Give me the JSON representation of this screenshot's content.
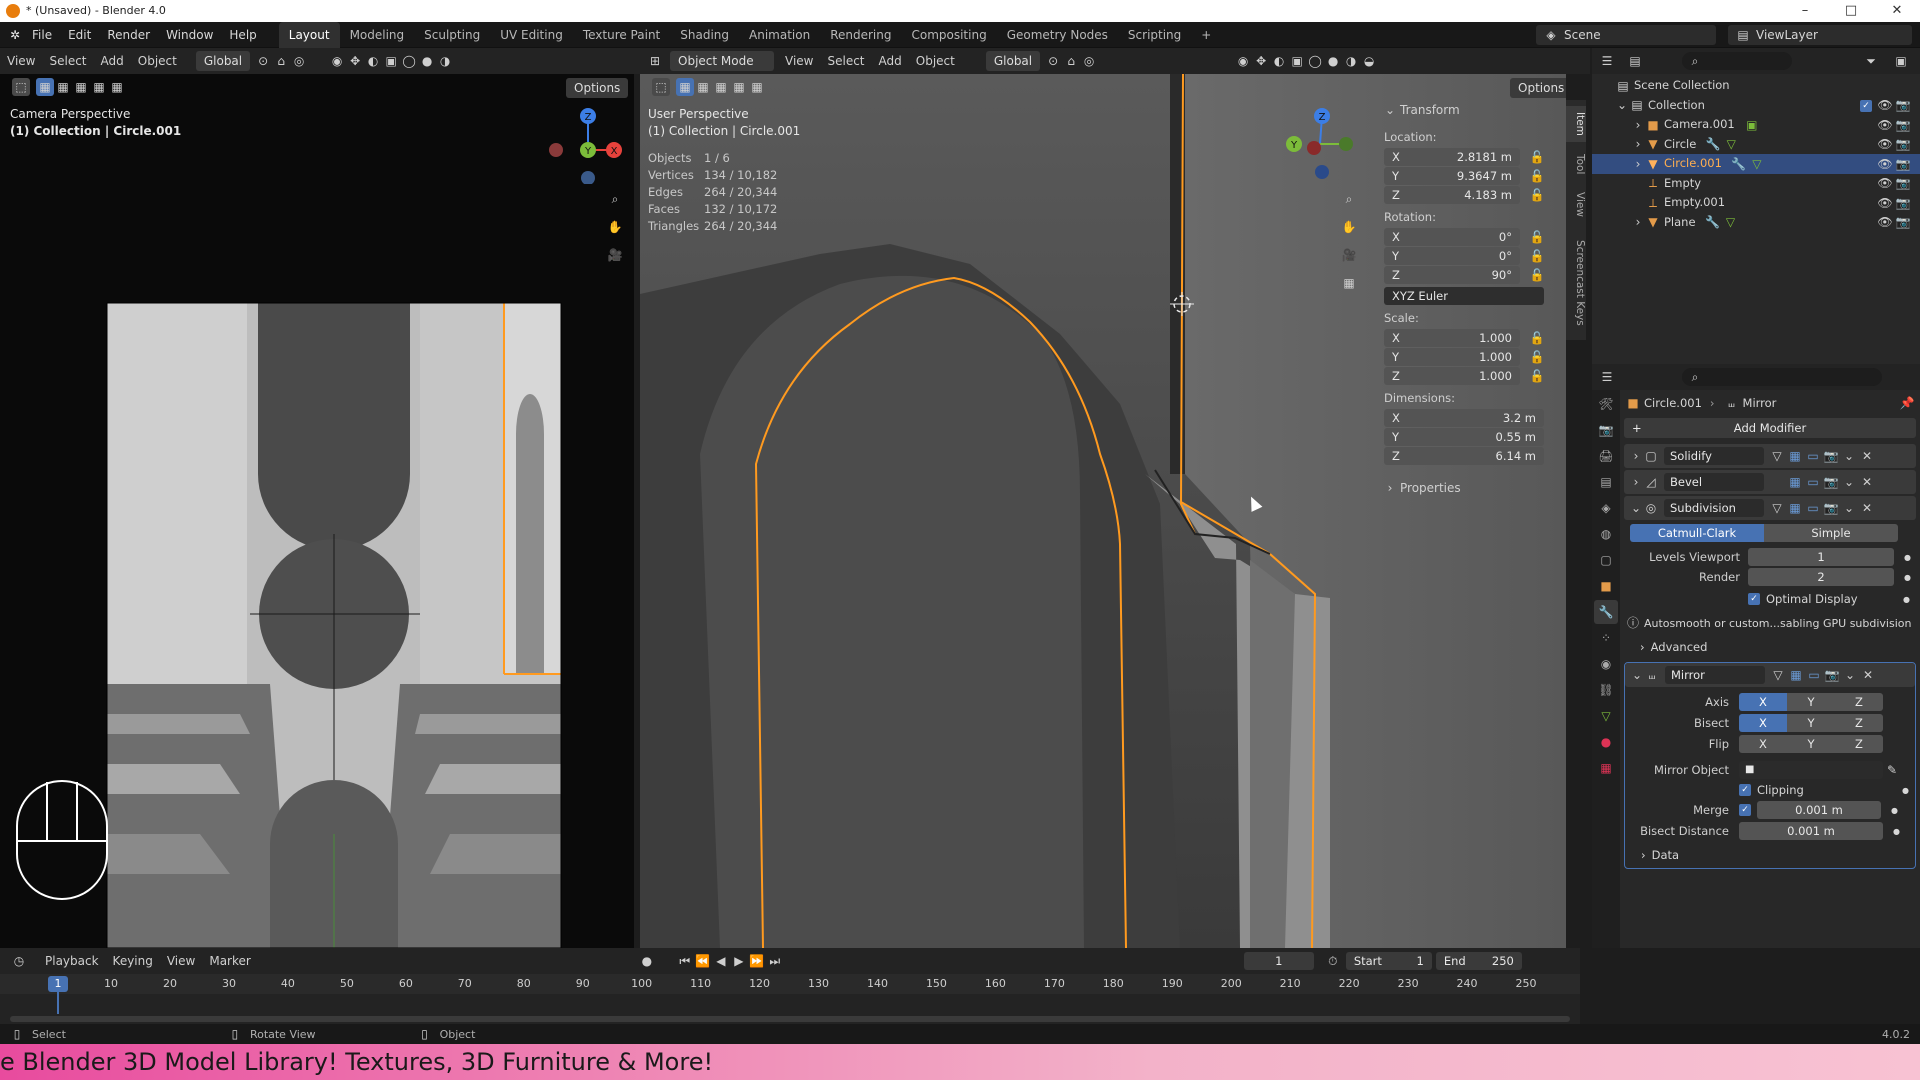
{
  "window": {
    "title": "* (Unsaved) - Blender 4.0",
    "minimize": "–",
    "maximize": "□",
    "close": "✕"
  },
  "menubar": [
    "File",
    "Edit",
    "Render",
    "Window",
    "Help"
  ],
  "workspaces": [
    "Layout",
    "Modeling",
    "Sculpting",
    "UV Editing",
    "Texture Paint",
    "Shading",
    "Animation",
    "Rendering",
    "Compositing",
    "Geometry Nodes",
    "Scripting"
  ],
  "workspace_add": "+",
  "scene": {
    "label": "Scene",
    "view_layer": "ViewLayer"
  },
  "left_view": {
    "header": [
      "View",
      "Select",
      "Add",
      "Object"
    ],
    "orientation": "Global",
    "options": "Options",
    "overlay_title": "Camera Perspective",
    "overlay_sub": "(1) Collection | Circle.001"
  },
  "mid_view": {
    "mode": "Object Mode",
    "header": [
      "View",
      "Select",
      "Add",
      "Object"
    ],
    "orientation": "Global",
    "options": "Options",
    "overlay_title": "User Perspective",
    "overlay_sub": "(1) Collection | Circle.001",
    "stats": [
      {
        "k": "Objects",
        "v": "1 / 6"
      },
      {
        "k": "Vertices",
        "v": "134 / 10,182"
      },
      {
        "k": "Edges",
        "v": "264 / 20,344"
      },
      {
        "k": "Faces",
        "v": "132 / 10,172"
      },
      {
        "k": "Triangles",
        "v": "264 / 20,344"
      }
    ]
  },
  "sidebar_tabs": [
    "Item",
    "Tool",
    "View",
    "Screencast Keys"
  ],
  "transform": {
    "title": "Transform",
    "location_label": "Location:",
    "location": [
      {
        "a": "X",
        "v": "2.8181 m"
      },
      {
        "a": "Y",
        "v": "9.3647 m"
      },
      {
        "a": "Z",
        "v": "4.183 m"
      }
    ],
    "rotation_label": "Rotation:",
    "rotation": [
      {
        "a": "X",
        "v": "0°"
      },
      {
        "a": "Y",
        "v": "0°"
      },
      {
        "a": "Z",
        "v": "90°"
      }
    ],
    "rotation_mode": "XYZ Euler",
    "scale_label": "Scale:",
    "scale": [
      {
        "a": "X",
        "v": "1.000"
      },
      {
        "a": "Y",
        "v": "1.000"
      },
      {
        "a": "Z",
        "v": "1.000"
      }
    ],
    "dimensions_label": "Dimensions:",
    "dimensions": [
      {
        "a": "X",
        "v": "3.2 m"
      },
      {
        "a": "Y",
        "v": "0.55 m"
      },
      {
        "a": "Z",
        "v": "6.14 m"
      }
    ],
    "properties": "Properties"
  },
  "outliner": {
    "root": "Scene Collection",
    "collection": "Collection",
    "items": [
      {
        "name": "Camera.001",
        "selected": false
      },
      {
        "name": "Circle",
        "selected": false
      },
      {
        "name": "Circle.001",
        "selected": true
      },
      {
        "name": "Empty",
        "selected": false
      },
      {
        "name": "Empty.001",
        "selected": false
      },
      {
        "name": "Plane",
        "selected": false
      }
    ]
  },
  "properties": {
    "breadcrumb_object": "Circle.001",
    "breadcrumb_modifier": "Mirror",
    "add_modifier": "Add Modifier",
    "modifiers": [
      "Solidify",
      "Bevel",
      "Subdivision"
    ],
    "subdivision": {
      "catmull": "Catmull-Clark",
      "simple": "Simple",
      "levels_label": "Levels Viewport",
      "levels_value": "1",
      "render_label": "Render",
      "render_value": "2",
      "optimal": "Optimal Display",
      "warning": "Autosmooth or custom...sabling GPU subdivision",
      "advanced": "Advanced"
    },
    "mirror": {
      "name": "Mirror",
      "axis_label": "Axis",
      "bisect_label": "Bisect",
      "flip_label": "Flip",
      "xyz": [
        "X",
        "Y",
        "Z"
      ],
      "mirror_object_label": "Mirror Object",
      "clipping": "Clipping",
      "merge_label": "Merge",
      "merge_value": "0.001 m",
      "bisect_distance_label": "Bisect Distance",
      "bisect_distance_value": "0.001 m",
      "data": "Data"
    }
  },
  "timeline": {
    "menus": [
      "Playback",
      "Keying",
      "View",
      "Marker"
    ],
    "current_frame": "1",
    "start_label": "Start",
    "start": "1",
    "end_label": "End",
    "end": "250",
    "ticks": [
      "1",
      "10",
      "20",
      "30",
      "40",
      "50",
      "60",
      "70",
      "80",
      "90",
      "100",
      "110",
      "120",
      "130",
      "140",
      "150",
      "160",
      "170",
      "180",
      "190",
      "200",
      "210",
      "220",
      "230",
      "240",
      "250"
    ]
  },
  "statusbar": {
    "select": "Select",
    "rotate": "Rotate View",
    "object": "Object",
    "version": "4.0.2"
  },
  "banner": "e Blender 3D Model Library! Textures, 3D Furniture & More!",
  "colors": {
    "accent": "#4772b3",
    "selection": "#ff9a1f",
    "x_axis": "#e6423c",
    "y_axis": "#7cbc3a",
    "z_axis": "#3c7ee6"
  }
}
